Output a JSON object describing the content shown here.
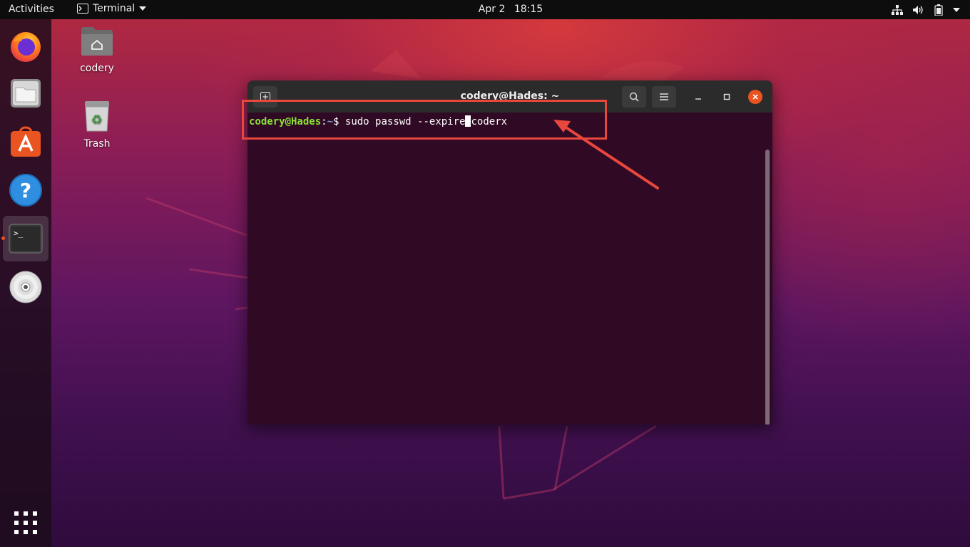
{
  "top_bar": {
    "activities_label": "Activities",
    "app_label": "Terminal",
    "date": "Apr 2",
    "time": "18:15",
    "tray_icons": [
      "network-icon",
      "volume-icon",
      "battery-icon",
      "system-menu-chevron-icon"
    ]
  },
  "dock": {
    "items": [
      {
        "name": "Firefox",
        "icon": "firefox-icon"
      },
      {
        "name": "Files",
        "icon": "files-icon"
      },
      {
        "name": "Ubuntu Software",
        "icon": "software-store-icon"
      },
      {
        "name": "Help",
        "icon": "help-icon"
      },
      {
        "name": "Terminal",
        "icon": "terminal-icon",
        "active": true
      },
      {
        "name": "DVD",
        "icon": "disc-icon"
      }
    ],
    "show_apps_icon": "app-grid-icon"
  },
  "desktop": {
    "icons": [
      {
        "label": "codery",
        "icon": "home-folder-icon"
      },
      {
        "label": "Trash",
        "icon": "trash-icon"
      }
    ]
  },
  "terminal": {
    "title": "codery@Hades: ~",
    "prompt_user_host": "codery@Hades",
    "prompt_separator": ":",
    "prompt_path": "~",
    "prompt_symbol": "$",
    "command_before_cursor": " sudo passwd --expire",
    "command_after_cursor": "coderx",
    "buttons": [
      "new-tab-icon",
      "search-icon",
      "hamburger-menu-icon",
      "minimize-icon",
      "maximize-icon",
      "close-icon"
    ]
  },
  "colors": {
    "accent": "#e95420",
    "annotation": "#e8473d",
    "prompt_green": "#8ae234",
    "prompt_blue": "#729fcf",
    "terminal_bg": "#300a24"
  }
}
